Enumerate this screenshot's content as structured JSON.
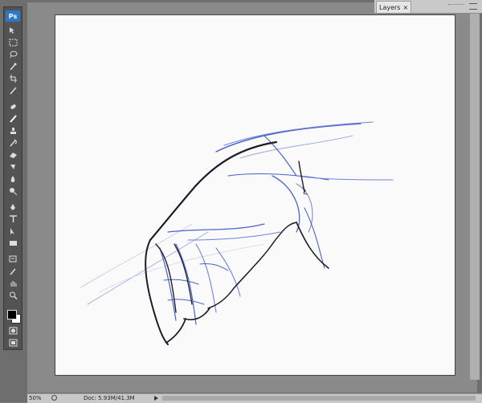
{
  "app": {
    "logo_text": "Ps"
  },
  "panels": {
    "layers_tab_label": "Layers",
    "close_glyph": "×"
  },
  "status": {
    "zoom": "50%",
    "doc_info": "Doc: 5.93M/41.3M"
  },
  "toolbar": {
    "tools": [
      "move-tool",
      "marquee-tool",
      "lasso-tool",
      "quick-selection-tool",
      "crop-tool",
      "slice-tool",
      "healing-brush-tool",
      "brush-tool",
      "clone-stamp-tool",
      "history-brush-tool",
      "eraser-tool",
      "gradient-tool",
      "blur-tool",
      "dodge-tool",
      "pen-tool",
      "type-tool",
      "path-selection-tool",
      "rectangle-tool",
      "notes-tool",
      "eyedropper-tool",
      "hand-tool",
      "zoom-tool"
    ]
  },
  "colors": {
    "foreground": "#000000",
    "background": "#ffffff",
    "sketch_blue": "#4a63c9",
    "sketch_dark": "#1c1c2a"
  }
}
